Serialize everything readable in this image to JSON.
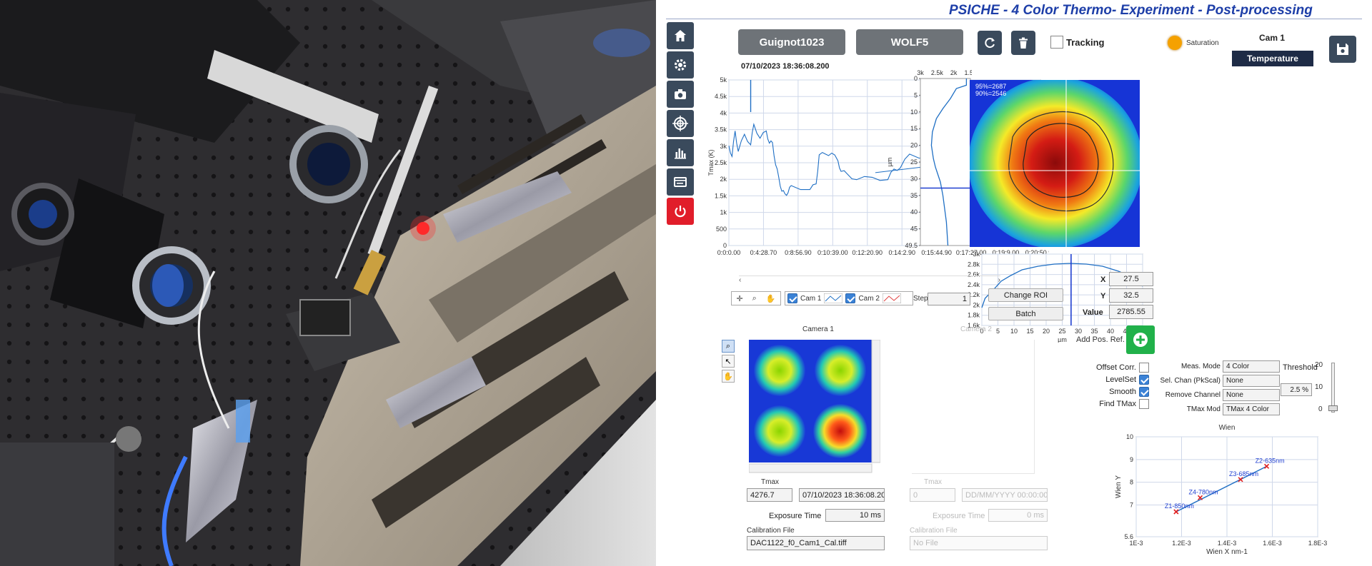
{
  "title": "PSICHE - 4 Color Thermo- Experiment - Post-processing",
  "nav": [
    "home-icon",
    "gear-icon",
    "camera-icon",
    "target-icon",
    "bar-chart-icon",
    "window-icon",
    "power-icon"
  ],
  "header": {
    "button1": "Guignot1023",
    "button2": "WOLF5",
    "tracking_label": "Tracking",
    "saturation_label": "Saturation",
    "saturation_color": "#f5a100",
    "cam_label": "Cam 1",
    "mode_value": "Temperature"
  },
  "main_chart": {
    "timestamp": "07/10/2023 18:36:08.200",
    "ylabel": "Tmax (K)",
    "yticks": [
      "5k",
      "4.5k",
      "4k",
      "3.5k",
      "3k",
      "2.5k",
      "2k",
      "1.5k",
      "1k",
      "500",
      "0"
    ],
    "xticks": [
      "0:0:0.00",
      "0:4:28.70",
      "0:8:56.90",
      "0:10:39.00",
      "0:12:20.90",
      "0:14:2.90",
      "0:15:44.90",
      "0:17:27.00",
      "0:19:9.00",
      "0:20:50.90"
    ]
  },
  "profile_v": {
    "ylabel": "µm",
    "xticks": [
      "3k",
      "2.5k",
      "2k",
      "1.5k"
    ],
    "yticks": [
      "0",
      "5",
      "10",
      "15",
      "20",
      "25",
      "30",
      "35",
      "40",
      "45",
      "49.5"
    ]
  },
  "heatmap_labels": [
    "95%=2687",
    "90%=2546"
  ],
  "profile_h": {
    "yticks": [
      "3k",
      "2.8k",
      "2.6k",
      "2.4k",
      "2.2k",
      "2k",
      "1.8k",
      "1.6k"
    ],
    "xticks": [
      "0",
      "5",
      "10",
      "15",
      "20",
      "25",
      "30",
      "35",
      "40",
      "45",
      "49."
    ],
    "xlabel": "µm"
  },
  "cursor": {
    "x_label": "X",
    "x_value": "27.5",
    "y_label": "Y",
    "y_value": "32.5",
    "value_label": "Value",
    "value_value": "2785.55"
  },
  "add_pos_ref": "Add Pos. Ref.",
  "toolbar": {
    "cam1": "Cam 1",
    "cam2": "Cam 2",
    "step_label": "Step",
    "step_value": "1",
    "change_roi": "Change ROI",
    "batch": "Batch"
  },
  "camera1": {
    "title": "Camera 1",
    "tmax_label": "Tmax",
    "tmax_value": "4276.7",
    "date_value": "07/10/2023 18:36:08.200",
    "exposure_label": "Exposure Time",
    "exposure_value": "10 ms",
    "calib_label": "Calibration File",
    "calib_value": "DAC1122_f0_Cam1_Cal.tiff"
  },
  "camera2": {
    "title": "Camera 2",
    "tmax_label": "Tmax",
    "tmax_value": "0",
    "date_value": "DD/MM/YYYY 00:00:00.0",
    "exposure_label": "Exposure Time",
    "exposure_value": "0 ms",
    "calib_label": "Calibration File",
    "calib_value": "No File"
  },
  "options": {
    "offset": "Offset Corr.",
    "levelset": "LevelSet",
    "smooth": "Smooth",
    "findtmax": "Find TMax"
  },
  "settings": {
    "meas_mode_label": "Meas. Mode",
    "meas_mode_value": "4 Color",
    "sel_chan_label": "Sel. Chan (PkScal)",
    "sel_chan_value": "None",
    "remove_label": "Remove Channel",
    "remove_value": "None",
    "tmax_mod_label": "TMax Mod",
    "tmax_mod_value": "TMax 4 Color",
    "threshold_label": "Threshold",
    "threshold_value": "2.5 %",
    "threshold_ticks": [
      "20",
      "10",
      "0"
    ]
  },
  "chart_data": {
    "type": "scatter",
    "title": "Wien",
    "xlabel": "Wien X nm-1",
    "ylabel": "Wien Y",
    "xlim": [
      0.001,
      0.0018
    ],
    "ylim": [
      5.6,
      10
    ],
    "xticks": [
      "1E-3",
      "1.2E-3",
      "1.4E-3",
      "1.6E-3",
      "1.8E-3"
    ],
    "yticks": [
      "10",
      "9",
      "8",
      "7",
      "5.6"
    ],
    "points": [
      {
        "label": "Z1-850nm",
        "x": 0.001176,
        "y": 6.7
      },
      {
        "label": "Z4-780nm",
        "x": 0.001282,
        "y": 7.32
      },
      {
        "label": "Z3-685nm",
        "x": 0.00146,
        "y": 8.12
      },
      {
        "label": "Z2-635nm",
        "x": 0.001575,
        "y": 8.7
      }
    ],
    "grid": true
  }
}
